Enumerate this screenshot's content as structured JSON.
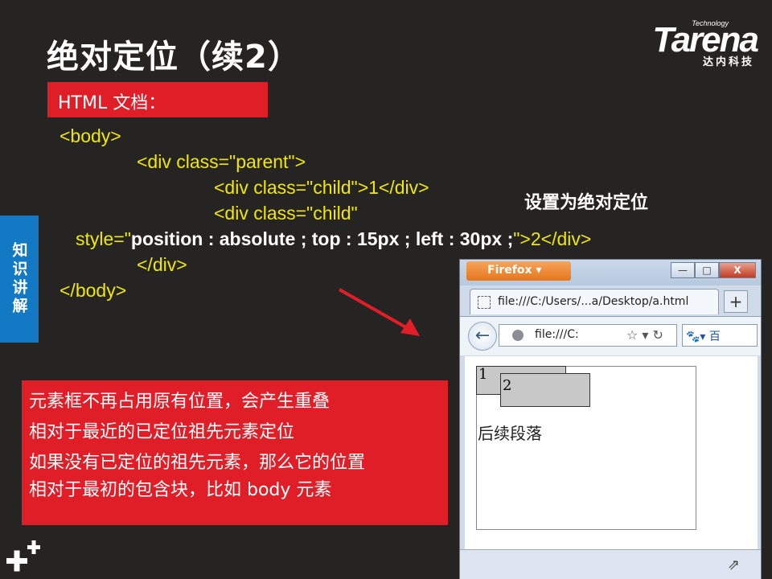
{
  "slide": {
    "title": "绝对定位（续2）",
    "logo": {
      "small": "Technology",
      "main": "Tarena",
      "sub": "达内科技"
    },
    "label": "HTML 文档：",
    "side_tab": "知识讲解",
    "annotation": "设置为绝对定位",
    "code": {
      "line1": "<body>",
      "line2": "<div class=\"parent\">",
      "line3": "<div class=\"child\">1</div>",
      "line4": "<div class=\"child\"",
      "line5_prefix": "style=\"",
      "line5_bold": "position : absolute ; top : 15px ; left : 30px ;",
      "line5_suffix": "\">2</div>",
      "line6": "</div>",
      "line7": "</body>"
    },
    "notes": [
      "元素框不再占用原有位置，会产生重叠",
      "相对于最近的已定位祖先元素定位",
      "如果没有已定位的祖先元素，那么它的位置",
      "相对于最初的包含块，比如 body 元素"
    ]
  },
  "browser": {
    "menu_button": "Firefox ▾",
    "window_controls": [
      "—",
      "□",
      "X"
    ],
    "tab_title": "file:///C:/Users/...a/Desktop/a.html",
    "new_tab": "+",
    "url": "file:///C:",
    "search_text": "百",
    "child1": "1",
    "child2": "2",
    "paragraph": "后续段落"
  },
  "colors": {
    "background": "#262422",
    "accent_red": "#e01e28",
    "side_blue": "#1479c4",
    "code_yellow": "#f0e800"
  }
}
